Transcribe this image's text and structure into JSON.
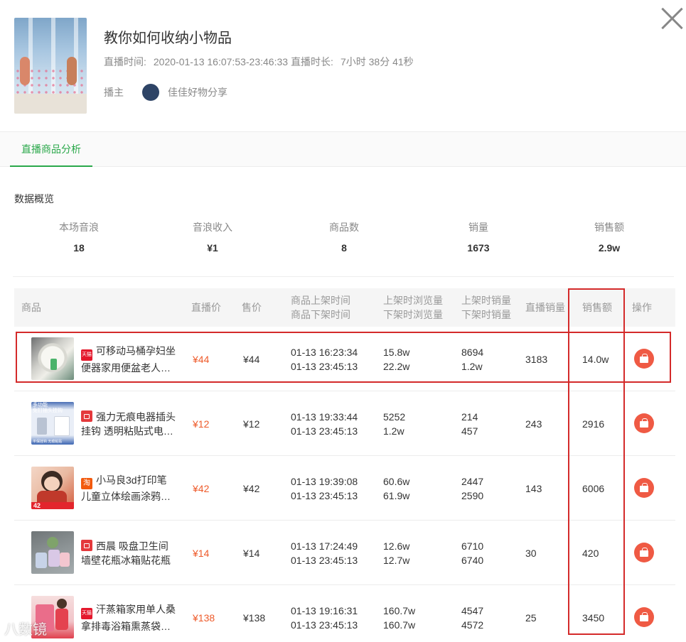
{
  "header": {
    "title": "教你如何收纳小物品",
    "time_label": "直播时间:",
    "time_value": "2020-01-13 16:07:53-23:46:33",
    "duration_label": "直播时长:",
    "duration_value": "7小时 38分 41秒",
    "host_label": "播主",
    "host_name": "佳佳好物分享"
  },
  "tabs": [
    {
      "label": "直播商品分析",
      "active": true
    }
  ],
  "overview": {
    "title": "数据概览",
    "stats": [
      {
        "label": "本场音浪",
        "value": "18"
      },
      {
        "label": "音浪收入",
        "value": "¥1"
      },
      {
        "label": "商品数",
        "value": "8"
      },
      {
        "label": "销量",
        "value": "1673"
      },
      {
        "label": "销售额",
        "value": "2.9w"
      }
    ]
  },
  "table": {
    "headers": {
      "product": "商品",
      "live_price": "直播价",
      "price": "售价",
      "on_time": "商品上架时间",
      "off_time": "商品下架时间",
      "on_views": "上架时浏览量",
      "off_views": "下架时浏览量",
      "on_sales": "上架时销量",
      "off_sales": "下架时销量",
      "live_sales": "直播销量",
      "revenue": "销售额",
      "action": "操作"
    },
    "rows": [
      {
        "platform": "tmall",
        "platform_text": "天猫",
        "name1": "可移动马桶孕妇坐",
        "name2": "便器家用便盆老人…",
        "live_price": "¥44",
        "price": "¥44",
        "on_time": "01-13 16:23:34",
        "off_time": "01-13 23:45:13",
        "on_views": "15.8w",
        "off_views": "22.2w",
        "on_sales": "8694",
        "off_sales": "1.2w",
        "live_sales": "3183",
        "revenue": "14.0w"
      },
      {
        "platform": "jd",
        "platform_text": "",
        "name1": "强力无痕电器插头",
        "name2": "挂钩 透明粘贴式电…",
        "live_price": "¥12",
        "price": "¥12",
        "on_time": "01-13 19:33:44",
        "off_time": "01-13 23:45:13",
        "on_views": "5252",
        "off_views": "1.2w",
        "on_sales": "214",
        "off_sales": "457",
        "live_sales": "243",
        "revenue": "2916"
      },
      {
        "platform": "taobao",
        "platform_text": "淘",
        "name1": "小马良3d打印笔",
        "name2": "儿童立体绘画涂鸦…",
        "live_price": "¥42",
        "price": "¥42",
        "on_time": "01-13 19:39:08",
        "off_time": "01-13 23:45:13",
        "on_views": "60.6w",
        "off_views": "61.9w",
        "on_sales": "2447",
        "off_sales": "2590",
        "live_sales": "143",
        "revenue": "6006"
      },
      {
        "platform": "jd",
        "platform_text": "",
        "name1": "西晨 吸盘卫生间",
        "name2": "墙壁花瓶冰箱贴花瓶",
        "live_price": "¥14",
        "price": "¥14",
        "on_time": "01-13 17:24:49",
        "off_time": "01-13 23:45:13",
        "on_views": "12.6w",
        "off_views": "12.7w",
        "on_sales": "6710",
        "off_sales": "6740",
        "live_sales": "30",
        "revenue": "420"
      },
      {
        "platform": "tmall",
        "platform_text": "天猫",
        "name1": "汗蒸箱家用单人桑",
        "name2": "拿排毒浴箱熏蒸袋…",
        "live_price": "¥138",
        "price": "¥138",
        "on_time": "01-13 19:16:31",
        "off_time": "01-13 23:45:13",
        "on_views": "160.7w",
        "off_views": "160.7w",
        "on_sales": "4547",
        "off_sales": "4572",
        "live_sales": "25",
        "revenue": "3450"
      }
    ]
  },
  "thumb_texts": {
    "row2_top": "多功能",
    "row2_mid": "免钉插头挂钩",
    "row2_bottom": "平保挂钩 无痕粘贴",
    "row3_price": "42"
  },
  "watermark": "八数镜"
}
